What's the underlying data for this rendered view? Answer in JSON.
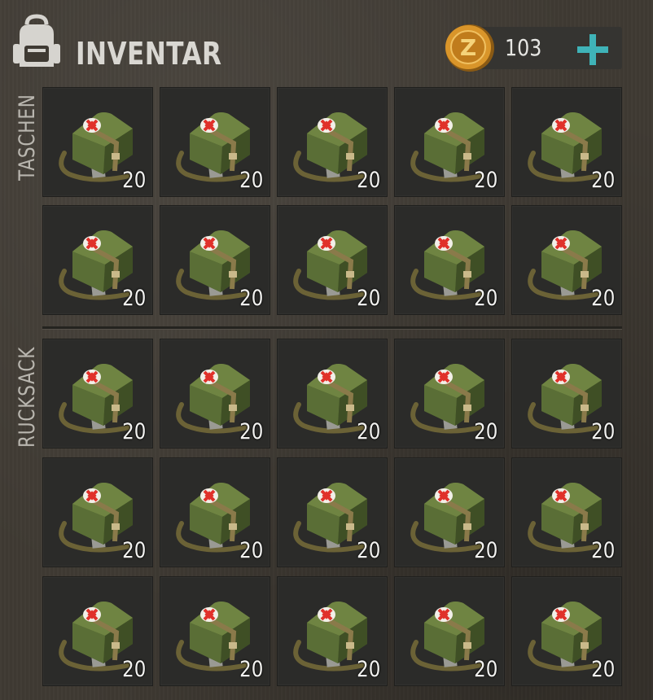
{
  "header": {
    "title": "INVENTAR",
    "icon": "backpack-icon"
  },
  "currency": {
    "icon": "coin-icon",
    "letter": "Z",
    "amount": "103",
    "add_icon": "plus-icon",
    "add_color": "#3fb3b8"
  },
  "sections": [
    {
      "label": "TASCHEN",
      "items": [
        {
          "icon": "medkit-icon",
          "count": "20"
        },
        {
          "icon": "medkit-icon",
          "count": "20"
        },
        {
          "icon": "medkit-icon",
          "count": "20"
        },
        {
          "icon": "medkit-icon",
          "count": "20"
        },
        {
          "icon": "medkit-icon",
          "count": "20"
        },
        {
          "icon": "medkit-icon",
          "count": "20"
        },
        {
          "icon": "medkit-icon",
          "count": "20"
        },
        {
          "icon": "medkit-icon",
          "count": "20"
        },
        {
          "icon": "medkit-icon",
          "count": "20"
        },
        {
          "icon": "medkit-icon",
          "count": "20"
        }
      ]
    },
    {
      "label": "RUCKSACK",
      "items": [
        {
          "icon": "medkit-icon",
          "count": "20"
        },
        {
          "icon": "medkit-icon",
          "count": "20"
        },
        {
          "icon": "medkit-icon",
          "count": "20"
        },
        {
          "icon": "medkit-icon",
          "count": "20"
        },
        {
          "icon": "medkit-icon",
          "count": "20"
        },
        {
          "icon": "medkit-icon",
          "count": "20"
        },
        {
          "icon": "medkit-icon",
          "count": "20"
        },
        {
          "icon": "medkit-icon",
          "count": "20"
        },
        {
          "icon": "medkit-icon",
          "count": "20"
        },
        {
          "icon": "medkit-icon",
          "count": "20"
        },
        {
          "icon": "medkit-icon",
          "count": "20"
        },
        {
          "icon": "medkit-icon",
          "count": "20"
        },
        {
          "icon": "medkit-icon",
          "count": "20"
        },
        {
          "icon": "medkit-icon",
          "count": "20"
        },
        {
          "icon": "medkit-icon",
          "count": "20"
        }
      ]
    }
  ]
}
